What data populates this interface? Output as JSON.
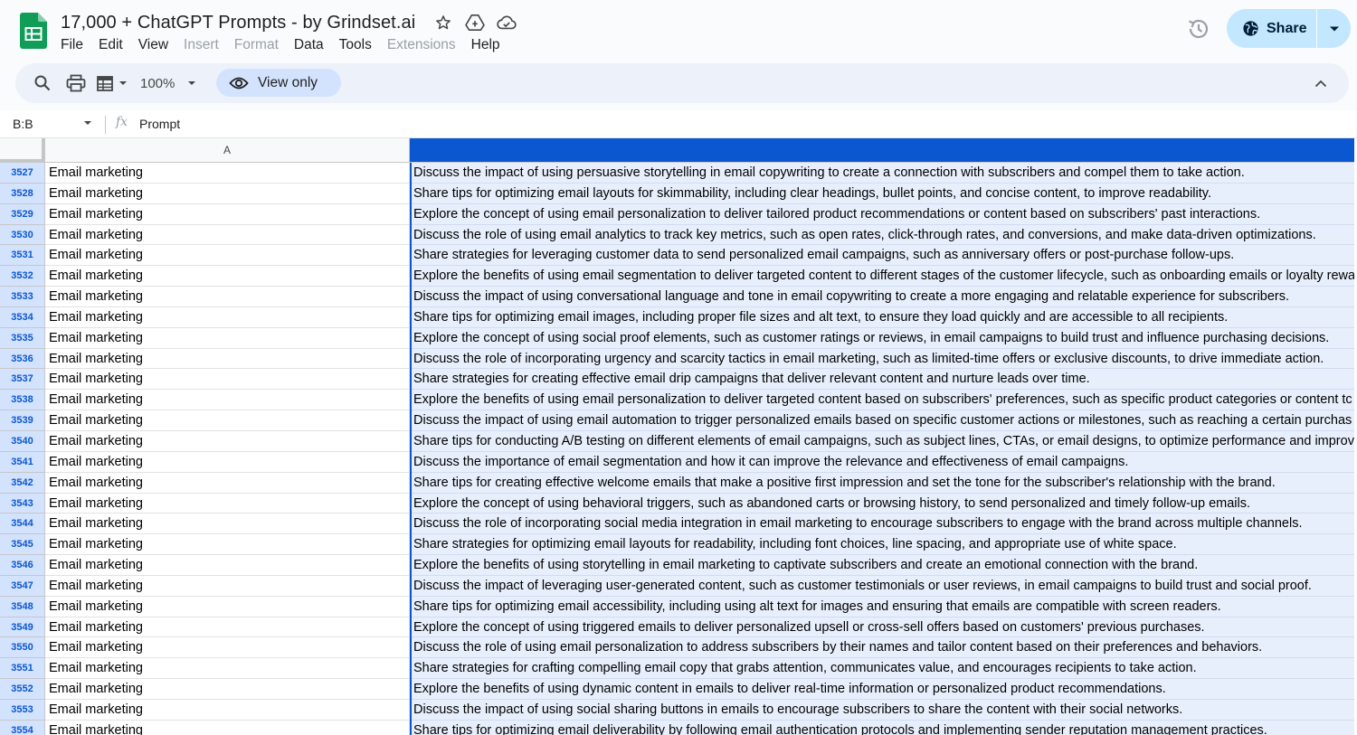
{
  "header": {
    "title": "17,000 + ChatGPT Prompts - by Grindset.ai",
    "menu": [
      {
        "label": "File",
        "enabled": true
      },
      {
        "label": "Edit",
        "enabled": true
      },
      {
        "label": "View",
        "enabled": true
      },
      {
        "label": "Insert",
        "enabled": false
      },
      {
        "label": "Format",
        "enabled": false
      },
      {
        "label": "Data",
        "enabled": true
      },
      {
        "label": "Tools",
        "enabled": true
      },
      {
        "label": "Extensions",
        "enabled": false
      },
      {
        "label": "Help",
        "enabled": true
      }
    ],
    "share_label": "Share"
  },
  "toolbar": {
    "zoom": "100%",
    "view_only_label": "View only"
  },
  "formula_bar": {
    "name_box": "B:B",
    "fx": "fx",
    "value": "Prompt"
  },
  "grid": {
    "column_a_header": "A",
    "column_b_header": "",
    "rows": [
      {
        "num": "3527",
        "a": "Email marketing",
        "b": "Discuss the impact of using persuasive storytelling in email copywriting to create a connection with subscribers and compel them to take action."
      },
      {
        "num": "3528",
        "a": "Email marketing",
        "b": "Share tips for optimizing email layouts for skimmability, including clear headings, bullet points, and concise content, to improve readability."
      },
      {
        "num": "3529",
        "a": "Email marketing",
        "b": "Explore the concept of using email personalization to deliver tailored product recommendations or content based on subscribers' past interactions."
      },
      {
        "num": "3530",
        "a": "Email marketing",
        "b": "Discuss the role of using email analytics to track key metrics, such as open rates, click-through rates, and conversions, and make data-driven optimizations."
      },
      {
        "num": "3531",
        "a": "Email marketing",
        "b": "Share strategies for leveraging customer data to send personalized email campaigns, such as anniversary offers or post-purchase follow-ups."
      },
      {
        "num": "3532",
        "a": "Email marketing",
        "b": "Explore the benefits of using email segmentation to deliver targeted content to different stages of the customer lifecycle, such as onboarding emails or loyalty rewa"
      },
      {
        "num": "3533",
        "a": "Email marketing",
        "b": "Discuss the impact of using conversational language and tone in email copywriting to create a more engaging and relatable experience for subscribers."
      },
      {
        "num": "3534",
        "a": "Email marketing",
        "b": "Share tips for optimizing email images, including proper file sizes and alt text, to ensure they load quickly and are accessible to all recipients."
      },
      {
        "num": "3535",
        "a": "Email marketing",
        "b": "Explore the concept of using social proof elements, such as customer ratings or reviews, in email campaigns to build trust and influence purchasing decisions."
      },
      {
        "num": "3536",
        "a": "Email marketing",
        "b": "Discuss the role of incorporating urgency and scarcity tactics in email marketing, such as limited-time offers or exclusive discounts, to drive immediate action."
      },
      {
        "num": "3537",
        "a": "Email marketing",
        "b": "Share strategies for creating effective email drip campaigns that deliver relevant content and nurture leads over time."
      },
      {
        "num": "3538",
        "a": "Email marketing",
        "b": "Explore the benefits of using email personalization to deliver targeted content based on subscribers' preferences, such as specific product categories or content tc"
      },
      {
        "num": "3539",
        "a": "Email marketing",
        "b": "Discuss the impact of using email automation to trigger personalized emails based on specific customer actions or milestones, such as reaching a certain purchas"
      },
      {
        "num": "3540",
        "a": "Email marketing",
        "b": "Share tips for conducting A/B testing on different elements of email campaigns, such as subject lines, CTAs, or email designs, to optimize performance and improv"
      },
      {
        "num": "3541",
        "a": "Email marketing",
        "b": "Discuss the importance of email segmentation and how it can improve the relevance and effectiveness of email campaigns."
      },
      {
        "num": "3542",
        "a": "Email marketing",
        "b": "Share tips for creating effective welcome emails that make a positive first impression and set the tone for the subscriber's relationship with the brand."
      },
      {
        "num": "3543",
        "a": "Email marketing",
        "b": "Explore the concept of using behavioral triggers, such as abandoned carts or browsing history, to send personalized and timely follow-up emails."
      },
      {
        "num": "3544",
        "a": "Email marketing",
        "b": "Discuss the role of incorporating social media integration in email marketing to encourage subscribers to engage with the brand across multiple channels."
      },
      {
        "num": "3545",
        "a": "Email marketing",
        "b": "Share strategies for optimizing email layouts for readability, including font choices, line spacing, and appropriate use of white space."
      },
      {
        "num": "3546",
        "a": "Email marketing",
        "b": "Explore the benefits of using storytelling in email marketing to captivate subscribers and create an emotional connection with the brand."
      },
      {
        "num": "3547",
        "a": "Email marketing",
        "b": "Discuss the impact of leveraging user-generated content, such as customer testimonials or user reviews, in email campaigns to build trust and social proof."
      },
      {
        "num": "3548",
        "a": "Email marketing",
        "b": "Share tips for optimizing email accessibility, including using alt text for images and ensuring that emails are compatible with screen readers."
      },
      {
        "num": "3549",
        "a": "Email marketing",
        "b": "Explore the concept of using triggered emails to deliver personalized upsell or cross-sell offers based on customers' previous purchases."
      },
      {
        "num": "3550",
        "a": "Email marketing",
        "b": "Discuss the role of using email personalization to address subscribers by their names and tailor content based on their preferences and behaviors."
      },
      {
        "num": "3551",
        "a": "Email marketing",
        "b": "Share strategies for crafting compelling email copy that grabs attention, communicates value, and encourages recipients to take action."
      },
      {
        "num": "3552",
        "a": "Email marketing",
        "b": "Explore the benefits of using dynamic content in emails to deliver real-time information or personalized product recommendations."
      },
      {
        "num": "3553",
        "a": "Email marketing",
        "b": "Discuss the impact of using social sharing buttons in emails to encourage subscribers to share the content with their social networks."
      },
      {
        "num": "3554",
        "a": "Email marketing",
        "b": "Share tips for optimizing email deliverability by following email authentication protocols and implementing sender reputation management practices."
      }
    ]
  },
  "colors": {
    "selection": "#0b57d0",
    "selection_fill": "#e8effc",
    "share_button": "#c2e7ff",
    "sheets_green": "#0f9d58"
  },
  "icons": [
    "sheets-logo-icon",
    "star-icon",
    "drive-move-icon",
    "cloud-status-icon",
    "history-icon",
    "globe-icon",
    "search-icon",
    "print-icon",
    "format-icon",
    "eye-icon",
    "chevron-up-icon"
  ]
}
